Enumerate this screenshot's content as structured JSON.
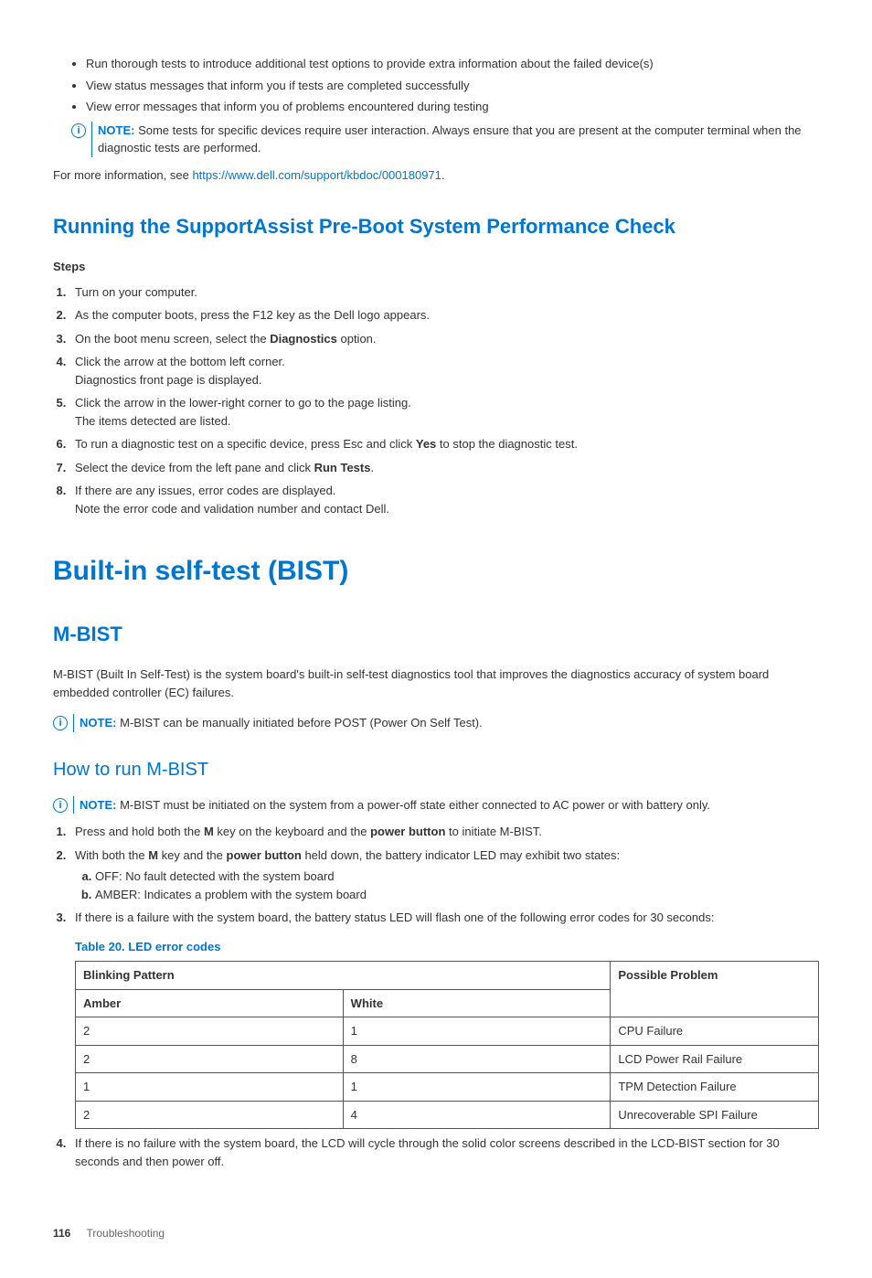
{
  "intro_bullets": [
    "Run thorough tests to introduce additional test options to provide extra information about the failed device(s)",
    "View status messages that inform you if tests are completed successfully",
    "View error messages that inform you of problems encountered during testing"
  ],
  "intro_note": {
    "label": "NOTE:",
    "text": " Some tests for specific devices require user interaction. Always ensure that you are present at the computer terminal when the diagnostic tests are performed."
  },
  "more_info": {
    "prefix": "For more information, see ",
    "link_text": "https://www.dell.com/support/kbdoc/000180971",
    "suffix": "."
  },
  "section_support": {
    "heading": "Running the SupportAssist Pre-Boot System Performance Check",
    "steps_label": "Steps",
    "steps": [
      {
        "text": "Turn on your computer."
      },
      {
        "text": "As the computer boots, press the F12 key as the Dell logo appears."
      },
      {
        "pre": "On the boot menu screen, select the ",
        "bold": "Diagnostics",
        "post": " option."
      },
      {
        "text": "Click the arrow at the bottom left corner.",
        "extra": "Diagnostics front page is displayed."
      },
      {
        "text": "Click the arrow in the lower-right corner to go to the page listing.",
        "extra": "The items detected are listed."
      },
      {
        "pre": "To run a diagnostic test on a specific device, press Esc and click ",
        "bold": "Yes",
        "post": " to stop the diagnostic test."
      },
      {
        "pre": "Select the device from the left pane and click ",
        "bold": "Run Tests",
        "post": "."
      },
      {
        "text": "If there are any issues, error codes are displayed.",
        "extra": "Note the error code and validation number and contact Dell."
      }
    ]
  },
  "section_bist": {
    "heading": "Built-in self-test (BIST)"
  },
  "section_mbist": {
    "heading": "M-BIST",
    "desc": "M-BIST (Built In Self-Test) is the system board's built-in self-test diagnostics tool that improves the diagnostics accuracy of system board embedded controller (EC) failures.",
    "note": {
      "label": "NOTE:",
      "text": " M-BIST can be manually initiated before POST (Power On Self Test)."
    }
  },
  "section_howto": {
    "heading": "How to run M-BIST",
    "note": {
      "label": "NOTE:",
      "text": " M-BIST must be initiated on the system from a power-off state either connected to AC power or with battery only."
    },
    "step1": {
      "pre": "Press and hold both the ",
      "b1": "M",
      "mid": " key on the keyboard and the ",
      "b2": "power button",
      "post": " to initiate M-BIST."
    },
    "step2": {
      "pre": "With both the ",
      "b1": "M",
      "mid": " key and the ",
      "b2": "power button",
      "post": " held down, the battery indicator LED may exhibit two states:"
    },
    "sub_a": "OFF: No fault detected with the system board",
    "sub_b": "AMBER: Indicates a problem with the system board",
    "step3": "If there is a failure with the system board, the battery status LED will flash one of the following error codes for 30 seconds:",
    "step4": "If there is no failure with the system board, the LCD will cycle through the solid color screens described in the LCD-BIST section for 30 seconds and then power off."
  },
  "table": {
    "caption": "Table 20. LED error codes",
    "hdr_blinking": "Blinking Pattern",
    "hdr_problem": "Possible Problem",
    "hdr_amber": "Amber",
    "hdr_white": "White",
    "rows": [
      {
        "amber": "2",
        "white": "1",
        "problem": "CPU Failure"
      },
      {
        "amber": "2",
        "white": "8",
        "problem": "LCD Power Rail Failure"
      },
      {
        "amber": "1",
        "white": "1",
        "problem": "TPM Detection Failure"
      },
      {
        "amber": "2",
        "white": "4",
        "problem": "Unrecoverable SPI Failure"
      }
    ]
  },
  "footer": {
    "page": "116",
    "section": "Troubleshooting"
  },
  "chart_data": {
    "type": "table",
    "title": "Table 20. LED error codes",
    "columns": [
      "Amber",
      "White",
      "Possible Problem"
    ],
    "rows": [
      [
        2,
        1,
        "CPU Failure"
      ],
      [
        2,
        8,
        "LCD Power Rail Failure"
      ],
      [
        1,
        1,
        "TPM Detection Failure"
      ],
      [
        2,
        4,
        "Unrecoverable SPI Failure"
      ]
    ]
  }
}
